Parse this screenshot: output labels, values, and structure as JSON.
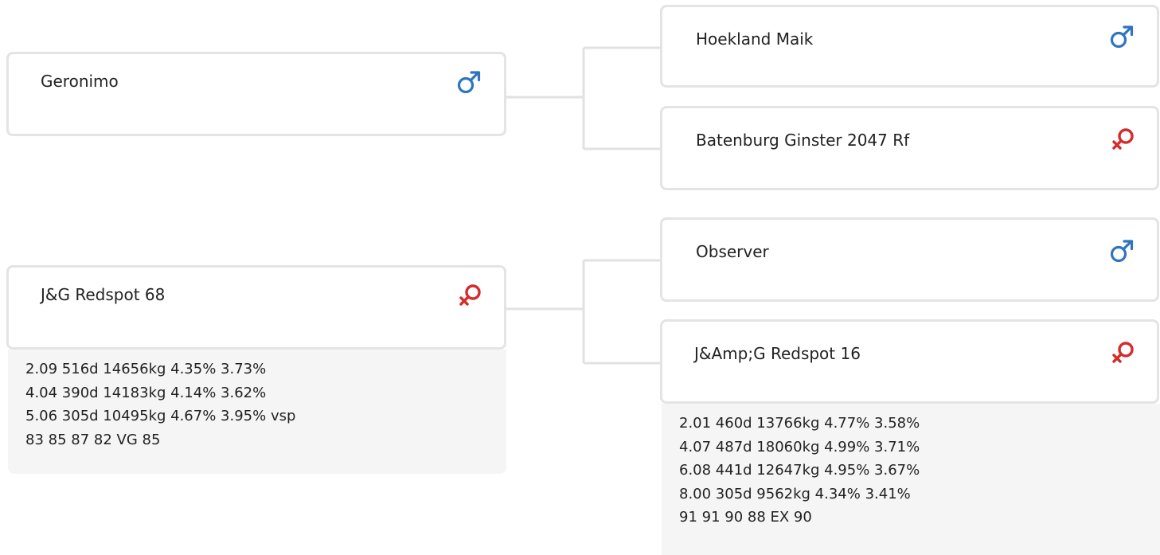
{
  "pedigree": {
    "sire": {
      "name": "Geronimo",
      "sex_icon": "male-icon",
      "sire": {
        "name": "Hoekland Maik",
        "sex_icon": "male-icon"
      },
      "dam": {
        "name": "Batenburg Ginster 2047 Rf",
        "sex_icon": "female-icon"
      }
    },
    "dam": {
      "name": "J&G Redspot 68",
      "sex_icon": "female-icon",
      "stats": [
        "2.09 516d 14656kg 4.35% 3.73%",
        "4.04 390d 14183kg 4.14% 3.62%",
        "5.06 305d 10495kg 4.67% 3.95% vsp",
        "83 85 87 82 VG 85"
      ],
      "sire": {
        "name": "Observer",
        "sex_icon": "male-icon"
      },
      "dam": {
        "name": "J&Amp;G Redspot 16",
        "sex_icon": "female-icon",
        "stats": [
          "2.01 460d 13766kg 4.77% 3.58%",
          "4.07 487d 18060kg 4.99% 3.71%",
          "6.08 441d 12647kg 4.95% 3.67%",
          "8.00 305d 9562kg 4.34% 3.41%",
          "91 91 90 88 EX 90"
        ]
      }
    }
  },
  "colors": {
    "male": "#2f74c0",
    "female": "#d42b2b",
    "card_border": "#e4e4e4",
    "stats_bg": "#f5f5f5",
    "connector": "#e2e2e2"
  }
}
